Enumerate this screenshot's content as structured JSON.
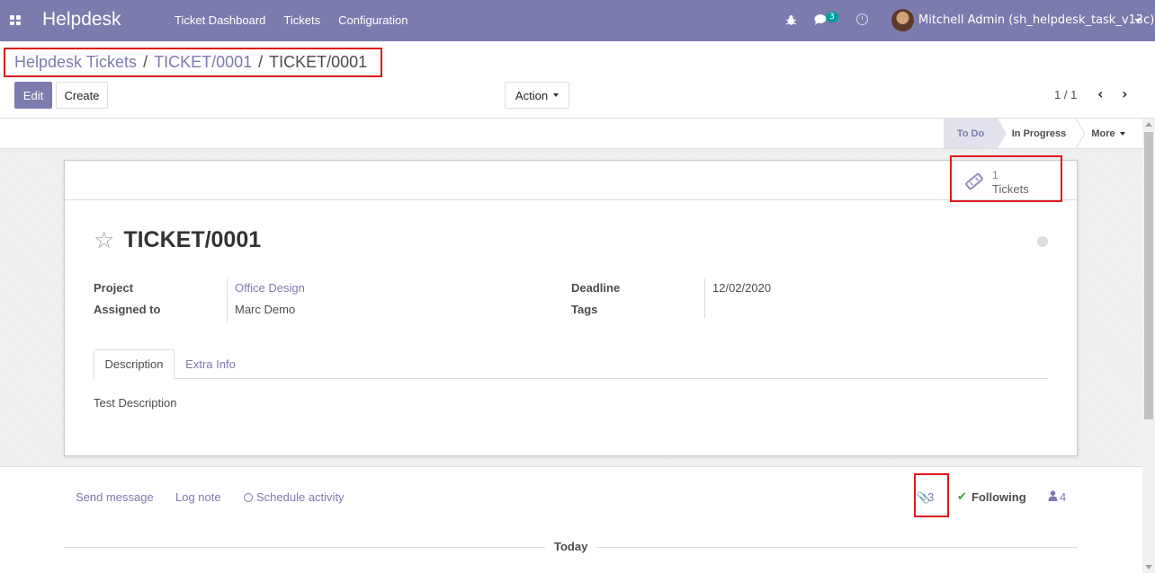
{
  "navbar": {
    "brand": "Helpdesk",
    "menu": [
      "Ticket Dashboard",
      "Tickets",
      "Configuration"
    ],
    "chat_badge": "3",
    "user_name": "Mitchell Admin (sh_helpdesk_task_v13c)",
    "bg_color": "#7c7bad"
  },
  "breadcrumb": {
    "items": [
      "Helpdesk Tickets",
      "TICKET/0001",
      "TICKET/0001"
    ],
    "separator": "/"
  },
  "buttons": {
    "edit": "Edit",
    "create": "Create",
    "action": "Action"
  },
  "pager": {
    "value": "1 / 1"
  },
  "statusbar": {
    "stages": [
      "To Do",
      "In Progress"
    ],
    "active_stage": "To Do",
    "more": "More"
  },
  "smart_button": {
    "value": "1",
    "label": "Tickets",
    "icon": "ticket-icon"
  },
  "record": {
    "title": "TICKET/0001",
    "fields_left": [
      {
        "label": "Project",
        "value": "Office Design"
      },
      {
        "label": "Assigned to",
        "value": "Marc Demo"
      }
    ],
    "fields_right": [
      {
        "label": "Deadline",
        "value": "12/02/2020"
      },
      {
        "label": "Tags",
        "value": ""
      }
    ]
  },
  "tabs": [
    "Description",
    "Extra Info"
  ],
  "description": "Test Description",
  "chatter": {
    "send_message": "Send message",
    "log_note": "Log note",
    "schedule_activity": "Schedule activity",
    "attachments": "3",
    "following": "Following",
    "followers": "4",
    "date_separator": "Today"
  },
  "colors": {
    "accent": "#7c7bad",
    "highlight_box": "#e01a1a",
    "success": "#28a745"
  }
}
